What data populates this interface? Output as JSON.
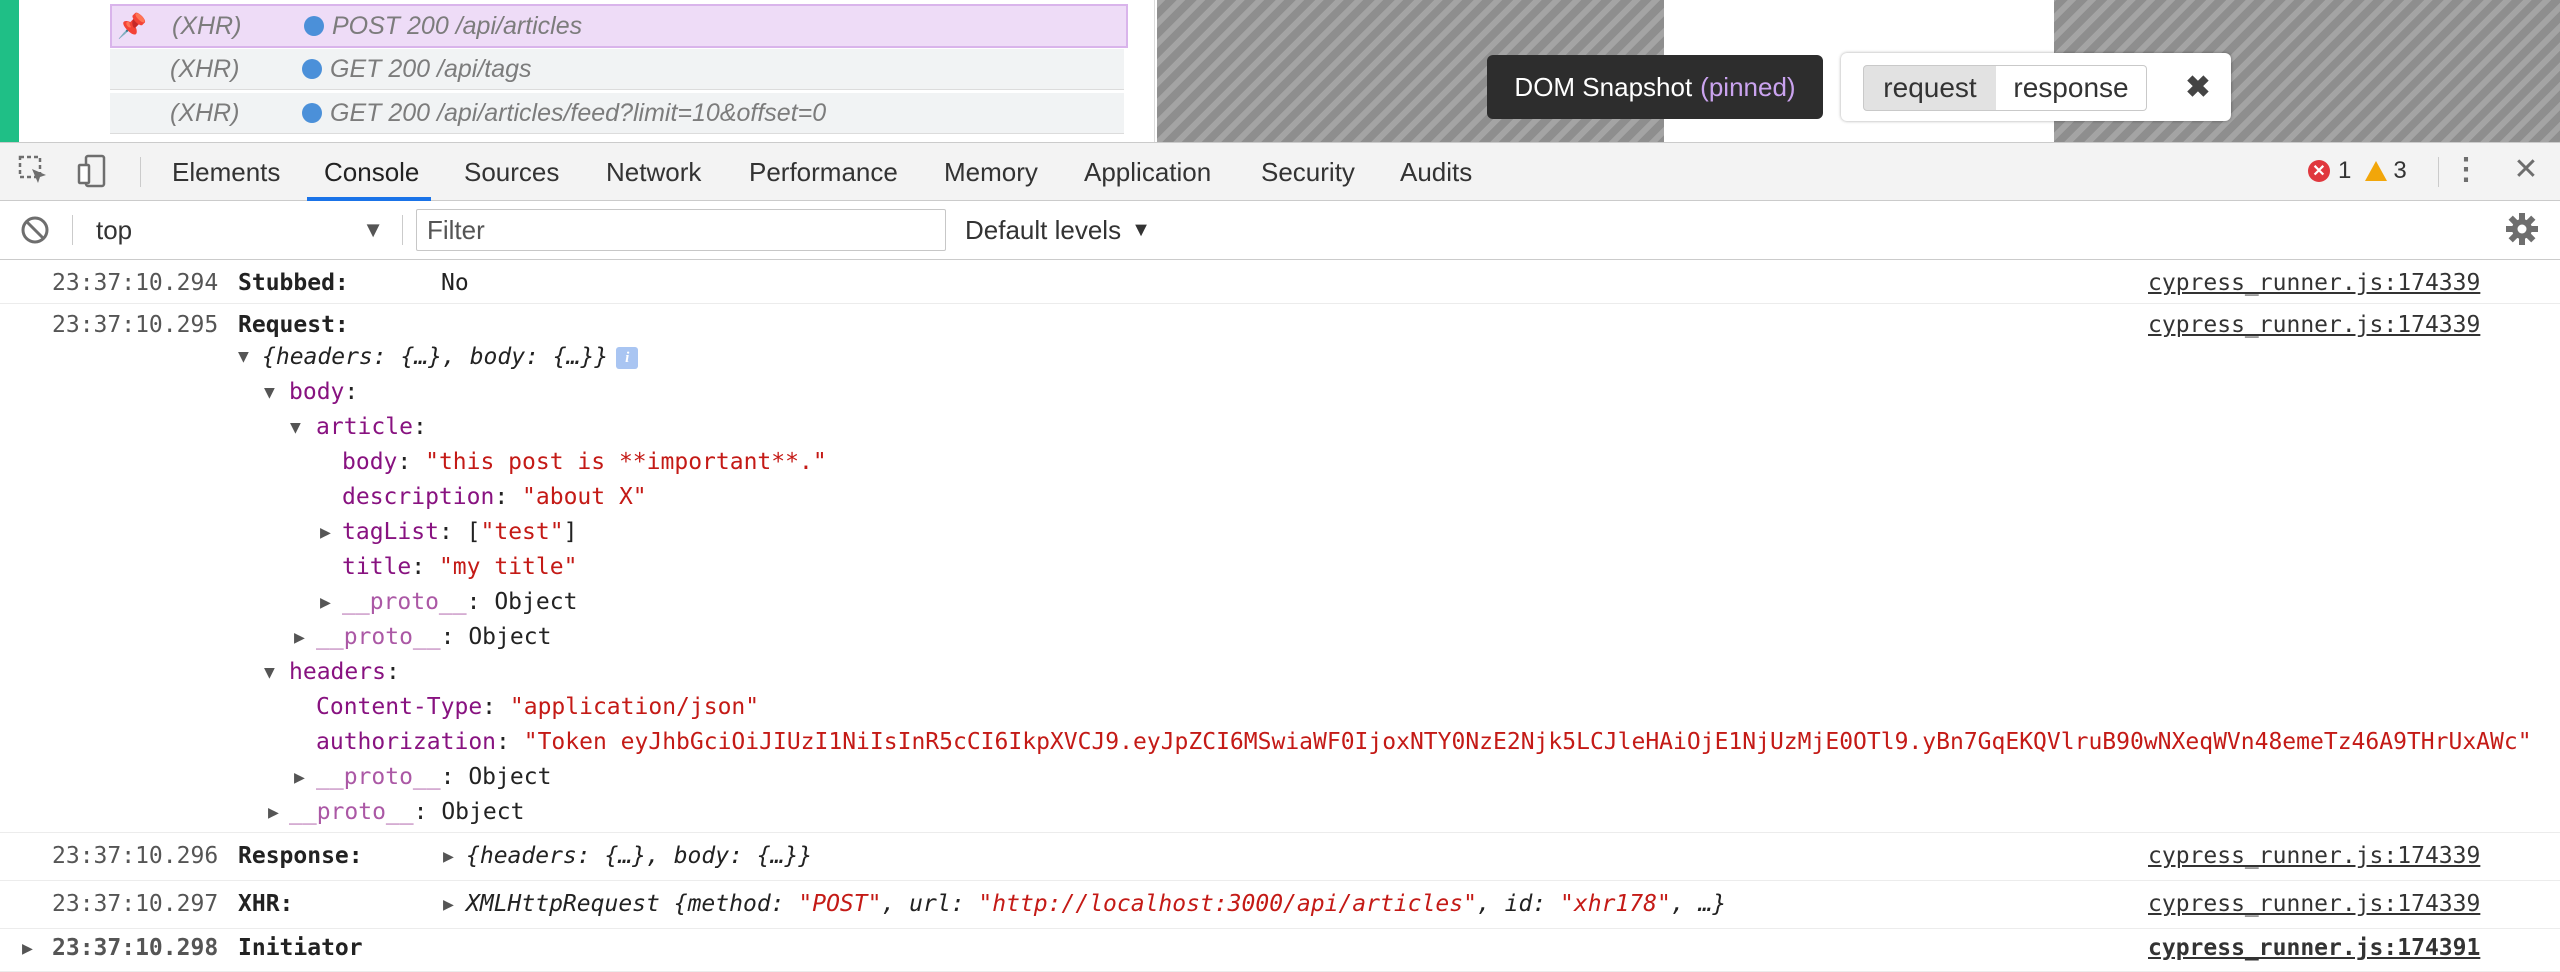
{
  "commands": [
    {
      "type": "(XHR)",
      "method": "POST",
      "status": "200",
      "url": "/api/articles",
      "pinned": true
    },
    {
      "type": "(XHR)",
      "method": "GET",
      "status": "200",
      "url": "/api/tags",
      "pinned": false
    },
    {
      "type": "(XHR)",
      "method": "GET",
      "status": "200",
      "url": "/api/articles/feed?limit=10&offset=0",
      "pinned": false
    }
  ],
  "snapshot": {
    "title": "DOM Snapshot",
    "pinned_label": "(pinned)",
    "request_label": "request",
    "response_label": "response",
    "close_glyph": "✖"
  },
  "devtools": {
    "tabs": [
      "Elements",
      "Console",
      "Sources",
      "Network",
      "Performance",
      "Memory",
      "Application",
      "Security",
      "Audits"
    ],
    "active_tab": "Console",
    "errors": "1",
    "warnings": "3"
  },
  "console_toolbar": {
    "context": "top",
    "filter_placeholder": "Filter",
    "levels": "Default levels"
  },
  "entries": {
    "stubbed": {
      "ts": "23:37:10.294",
      "label": "Stubbed:",
      "value": "No",
      "source": "cypress_runner.js:174339"
    },
    "request": {
      "ts": "23:37:10.295",
      "label": "Request:",
      "source": "cypress_runner.js:174339",
      "summary": "{headers: {…}, body: {…}}",
      "body_key": "body",
      "article_key": "article",
      "article_body_key": "body",
      "article_body_val": "\"this post is **important**.\"",
      "description_key": "description",
      "description_val": "\"about X\"",
      "taglist_key": "tagList",
      "taglist_open": "[",
      "taglist_item": "\"test\"",
      "taglist_close": "]",
      "title_key": "title",
      "title_val": "\"my title\"",
      "proto_key": "__proto__",
      "proto_val": "Object",
      "headers_key": "headers",
      "content_type_key": "Content-Type",
      "content_type_val": "\"application/json\"",
      "auth_key": "authorization",
      "auth_val": "\"Token eyJhbGciOiJIUzI1NiIsInR5cCI6IkpXVCJ9.eyJpZCI6MSwiaWF0IjoxNTY0NzE2Njk5LCJleHAiOjE1NjUzMjE0OTl9.yBn7GqEKQVlruB90wNXeqWVn48emeTz46A9THrUxAWc\""
    },
    "response": {
      "ts": "23:37:10.296",
      "label": "Response:",
      "summary": "{headers: {…}, body: {…}}",
      "source": "cypress_runner.js:174339"
    },
    "xhr": {
      "ts": "23:37:10.297",
      "label": "XHR:",
      "class_name": "XMLHttpRequest",
      "method_key": "method",
      "method_val": "\"POST\"",
      "url_key": "url",
      "url_val": "\"http://localhost:3000/api/articles\"",
      "id_key": "id",
      "id_val": "\"xhr178\"",
      "ellipsis": "…}",
      "source": "cypress_runner.js:174339"
    },
    "initiator": {
      "ts": "23:37:10.298",
      "label": "Initiator",
      "source": "cypress_runner.js:174391"
    }
  }
}
